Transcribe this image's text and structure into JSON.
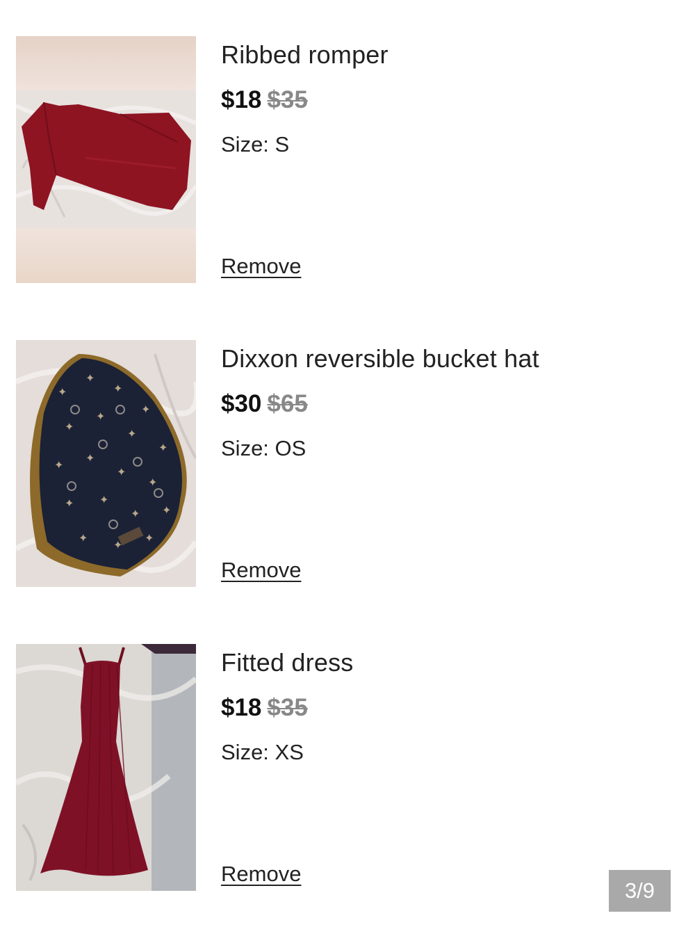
{
  "items": [
    {
      "title": "Ribbed romper",
      "price": "$18",
      "original_price": "$35",
      "size": "Size: S",
      "remove_label": "Remove",
      "image_icon": "romper-photo"
    },
    {
      "title": "Dixxon reversible bucket hat",
      "price": "$30",
      "original_price": "$65",
      "size": "Size: OS",
      "remove_label": "Remove",
      "image_icon": "bucket-hat-photo"
    },
    {
      "title": "Fitted dress",
      "price": "$18",
      "original_price": "$35",
      "size": "Size: XS",
      "remove_label": "Remove",
      "image_icon": "dress-photo"
    }
  ],
  "pager": {
    "label": "3/9"
  },
  "colors": {
    "accent_text": "#222222",
    "strike_price": "#888888",
    "pager_bg": "#a9a9a9",
    "garment_red": "#8e1422"
  }
}
